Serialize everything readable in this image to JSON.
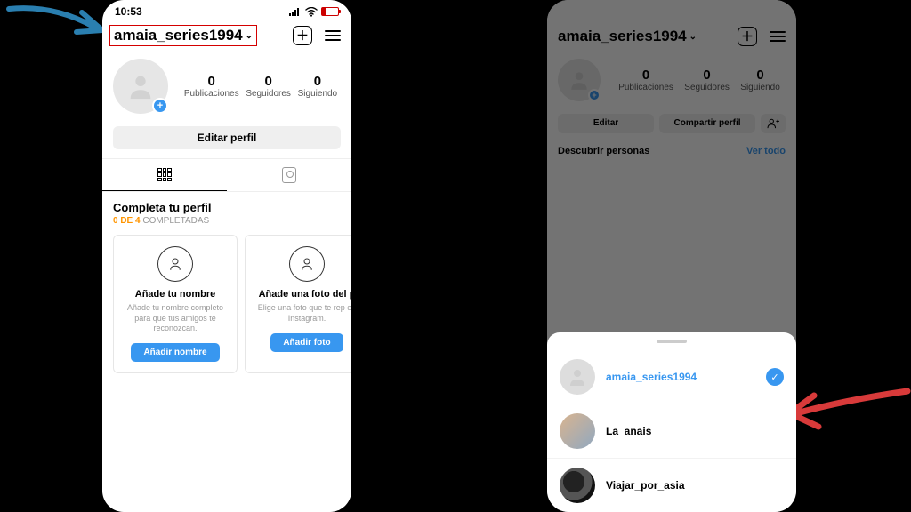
{
  "phone1": {
    "status_time": "10:53",
    "username": "amaia_series1994",
    "stats": [
      {
        "n": "0",
        "l": "Publicaciones"
      },
      {
        "n": "0",
        "l": "Seguidores"
      },
      {
        "n": "0",
        "l": "Siguiendo"
      }
    ],
    "edit_label": "Editar perfil",
    "completion": {
      "title": "Completa tu perfil",
      "progress_a": "0 DE 4",
      "progress_b": " COMPLETADAS"
    },
    "cards": [
      {
        "title": "Añade tu nombre",
        "desc": "Añade tu nombre completo para que tus amigos te reconozcan.",
        "cta": "Añadir nombre"
      },
      {
        "title": "Añade una foto del p",
        "desc": "Elige una foto que te rep en Instagram.",
        "cta": "Añadir foto"
      }
    ]
  },
  "phone2": {
    "username": "amaia_series1994",
    "stats": [
      {
        "n": "0",
        "l": "Publicaciones"
      },
      {
        "n": "0",
        "l": "Seguidores"
      },
      {
        "n": "0",
        "l": "Siguiendo"
      }
    ],
    "buttons": {
      "edit": "Editar",
      "share": "Compartir perfil"
    },
    "discover": {
      "label": "Descubrir personas",
      "link": "Ver todo"
    },
    "sheet_accounts": [
      {
        "name": "amaia_series1994",
        "selected": true,
        "blue": true
      },
      {
        "name": "La_anais",
        "selected": false,
        "blue": false
      },
      {
        "name": "Viajar_por_asia",
        "selected": false,
        "blue": false
      }
    ]
  }
}
